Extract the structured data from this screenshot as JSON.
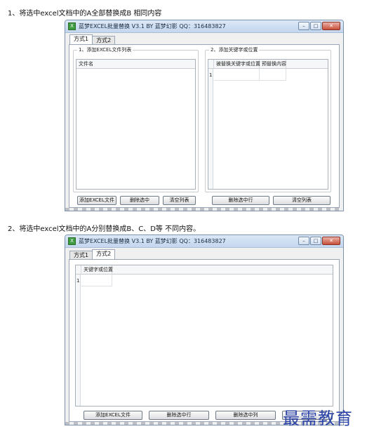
{
  "captions": {
    "step1": "1、将选中excel文档中的A全部替换成B 相同内容",
    "step2": "2、将选中excel文档中的A分别替换成B、C、D等 不同内容。"
  },
  "window_top": {
    "title": "蓝梦EXCEL批量替换 V3.1 BY 蓝梦幻影 QQ：316483827",
    "app_icon": "X",
    "controls": {
      "minimize": "–",
      "maximize": "□",
      "close": "✕"
    },
    "tabs": [
      {
        "label": "方式1"
      },
      {
        "label": "方式2"
      }
    ],
    "active_tab": 0,
    "group_files": {
      "title": "1、添加EXCEL文件列表",
      "column_header": "文件名"
    },
    "group_keywords": {
      "title": "2、添加关键字或位置",
      "columns": [
        "被替换关键字或位置",
        "预替换内容"
      ],
      "rows": [
        {
          "num": "1",
          "key": "",
          "value": ""
        }
      ]
    },
    "buttons": {
      "add_excel": "添加EXCEL文件",
      "delete_selected": "删除选中",
      "clear_list_left": "清空列表",
      "delete_selected_row": "删除选中行",
      "clear_list_right": "清空列表"
    }
  },
  "window_bottom": {
    "title": "蓝梦EXCEL批量替换 V3.1 BY 蓝梦幻影 QQ：316483827",
    "app_icon": "X",
    "controls": {
      "minimize": "–",
      "maximize": "□",
      "close": "✕"
    },
    "tabs": [
      {
        "label": "方式1"
      },
      {
        "label": "方式2"
      }
    ],
    "active_tab": 1,
    "grid": {
      "column_header": "关键字或位置",
      "rows": [
        {
          "num": "1"
        }
      ]
    },
    "buttons": {
      "add_excel": "添加EXCEL文件",
      "delete_selected_row": "删除选中行",
      "delete_selected_column": "删除选中列"
    }
  },
  "watermark": "最需教育",
  "colors": {
    "titlebar": "#c4d7ee",
    "close_button": "#c9503a",
    "watermark": "#2c43a8"
  }
}
